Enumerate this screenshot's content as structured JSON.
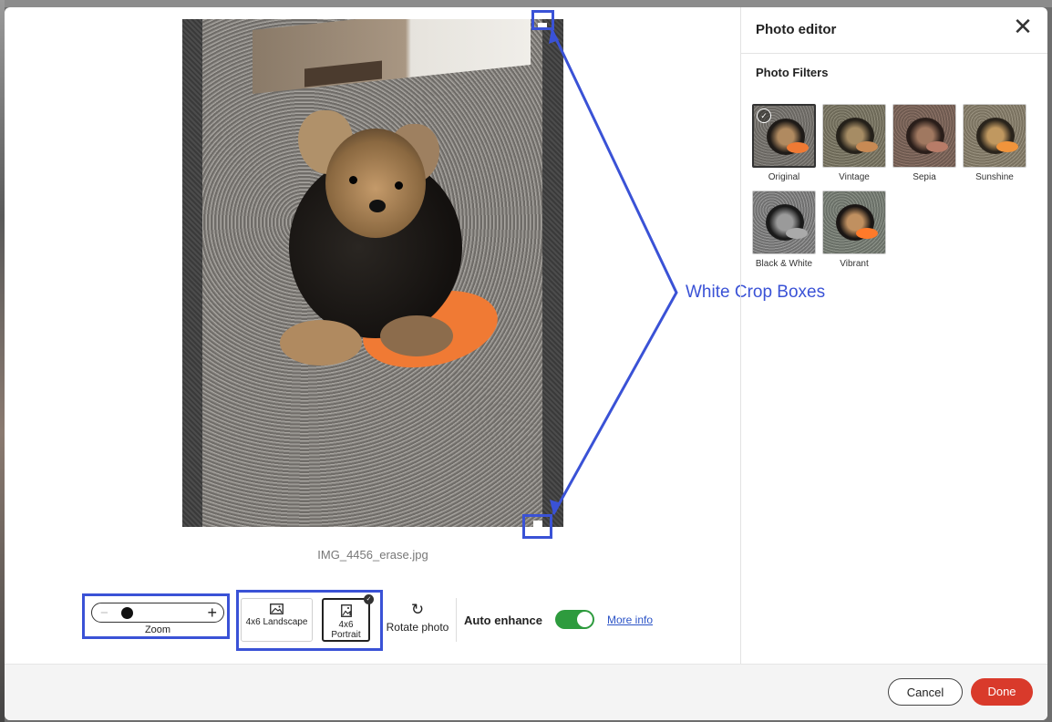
{
  "editor": {
    "filename": "IMG_4456_erase.jpg"
  },
  "annotation": {
    "label": "White Crop Boxes",
    "color": "#3a52d6"
  },
  "toolbar": {
    "zoom_label": "Zoom",
    "zoom_minus": "−",
    "zoom_plus": "+",
    "landscape_label": "4x6 Landscape",
    "portrait_label": "4x6 Portrait",
    "rotate_label": "Rotate photo",
    "auto_enhance_label": "Auto enhance",
    "auto_enhance_on": true,
    "more_info": "More info"
  },
  "panel": {
    "title": "Photo editor",
    "close": "✕",
    "filters_title": "Photo Filters",
    "filters": [
      {
        "label": "Original"
      },
      {
        "label": "Vintage"
      },
      {
        "label": "Sepia"
      },
      {
        "label": "Sunshine"
      },
      {
        "label": "Black & White"
      },
      {
        "label": "Vibrant"
      }
    ]
  },
  "footer": {
    "cancel": "Cancel",
    "done": "Done"
  },
  "colors": {
    "accent_red": "#d93a2b",
    "toggle_green": "#2e9b3e",
    "link_blue": "#2c54c7"
  }
}
